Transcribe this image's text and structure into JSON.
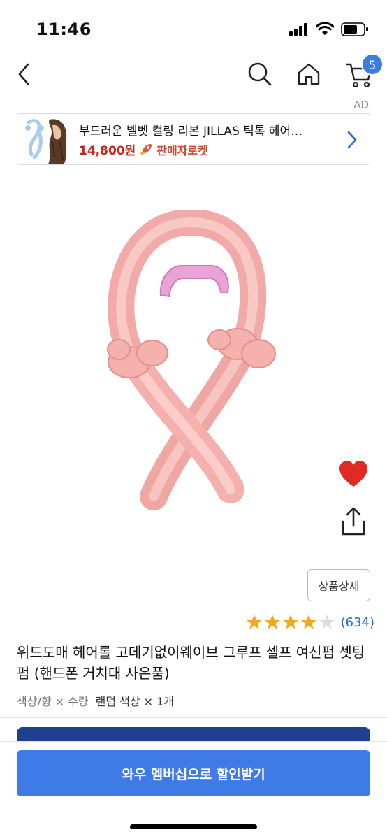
{
  "status_bar": {
    "time": "11:46"
  },
  "nav": {
    "cart_count": "5"
  },
  "ad": {
    "label": "AD",
    "title": "부드러운 벨벳 컬링 리본 JILLAS 틱톡 헤어…",
    "price": "14,800원",
    "badge_text": "판매자로켓"
  },
  "product": {
    "detail_button": "상품상세",
    "rating": 4,
    "rating_max": 5,
    "review_count": "(634)",
    "title": "위드도매 헤어롤 고데기없이웨이브 그루프 셀프 여신펌 셋팅펌 (핸드폰 거치대 사은품)",
    "option_label": "색상/향 × 수량",
    "option_value": "랜덤 색상 × 1개"
  },
  "cta": {
    "label": "와우 멤버십으로 할인받기"
  },
  "colors": {
    "accent": "#3e7be6",
    "price_red": "#c9261a",
    "heart": "#e02a24",
    "star": "#f5a623"
  },
  "icons": [
    "back-icon",
    "search-icon",
    "home-icon",
    "cart-icon",
    "chevron-right-icon",
    "rocket-icon",
    "heart-icon",
    "share-icon",
    "star-icon"
  ]
}
